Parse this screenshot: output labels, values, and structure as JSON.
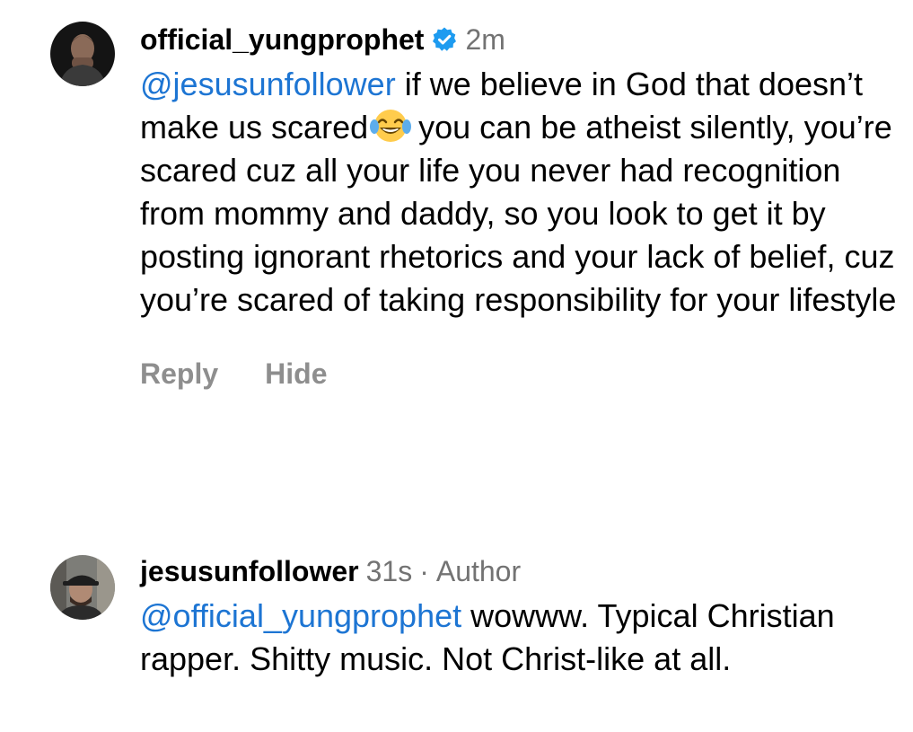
{
  "comments": [
    {
      "username": "official_yungprophet",
      "verified": true,
      "time": "2m",
      "mention": "@jesusunfollower",
      "text_before_emoji": "if we believe in God that doesn’t make us scared",
      "emoji": "face-with-tears-of-joy",
      "text_after_emoji": "you can be atheist silently, you’re scared cuz all your life you never had recognition from mommy and daddy, so you look to get it by posting ignorant rhetorics and your lack of belief, cuz you’re scared of taking responsibility for your lifestyle",
      "actions": {
        "reply": "Reply",
        "hide": "Hide"
      }
    },
    {
      "username": "jesusunfollower",
      "time": "31s",
      "separator": "·",
      "author_label": "Author",
      "mention": "@official_yungprophet",
      "text": "wowww. Typical Christian rapper. Shitty music. Not Christ-like at all."
    }
  ],
  "colors": {
    "mention": "#1d75d3",
    "meta": "#737373",
    "action": "#8e8e8e",
    "verified": "#1d9bf0"
  }
}
